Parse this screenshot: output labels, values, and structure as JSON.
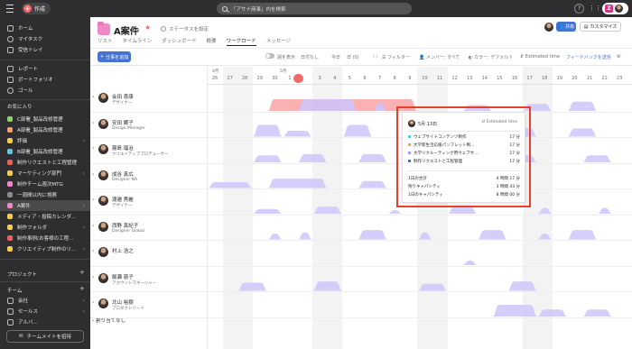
{
  "topbar": {
    "create_label": "作成",
    "search_placeholder": "「アサナ商事」内を検索",
    "help": "?",
    "org_letter": "Z"
  },
  "sidebar": {
    "nav": [
      {
        "label": "ホーム",
        "icon": "home-icon"
      },
      {
        "label": "マイタスク",
        "icon": "check-circle-icon"
      },
      {
        "label": "受信トレイ",
        "icon": "bell-icon"
      }
    ],
    "insights": [
      {
        "label": "レポート",
        "icon": "chart-icon"
      },
      {
        "label": "ポートフォリオ",
        "icon": "folder-icon"
      },
      {
        "label": "ゴール",
        "icon": "person-icon"
      }
    ],
    "favorites_heading": "お気に入り",
    "favorites": [
      {
        "label": "C部署_製品改修管理",
        "color": "#8fd16a",
        "has_chevron": false
      },
      {
        "label": "A部署_製品改修管理",
        "color": "#f2a36b",
        "has_chevron": false
      },
      {
        "label": "評価",
        "color": "#f6cc4f",
        "has_chevron": true
      },
      {
        "label": "B部署_製品改修管理",
        "color": "#62c5d9",
        "has_chevron": false
      },
      {
        "label": "制作リクエストと工程管理",
        "color": "#e8615f",
        "has_chevron": false
      },
      {
        "label": "マーケティング部門",
        "color": "#f6cc4f",
        "has_chevron": true
      },
      {
        "label": "制作チーム週次MTG",
        "color": "#f288c8",
        "has_chevron": false
      },
      {
        "label": "一週間以内に視察",
        "color": "#8a8a8c",
        "has_chevron": false
      },
      {
        "label": "A案件",
        "color": "#f288c8",
        "has_chevron": true,
        "active": true
      },
      {
        "label": "メディア・投稿カレンダ...",
        "color": "#f6cc4f",
        "has_chevron": false
      },
      {
        "label": "制作フォルダ",
        "color": "#f6cc4f",
        "has_chevron": true
      },
      {
        "label": "制作事例(お客様の工程...",
        "color": "#e8615f",
        "has_chevron": false
      },
      {
        "label": "クリエイティブ制作のリ...",
        "color": "#f6cc4f",
        "has_chevron": true
      }
    ],
    "projects_heading": "プロジェクト",
    "team_heading": "チーム",
    "teams": [
      {
        "label": "会社"
      },
      {
        "label": "セールス"
      },
      {
        "label": "アルバ..."
      }
    ],
    "invite_label": "チームメイトを招待"
  },
  "project": {
    "title": "A案件",
    "status_label": "ステータスを設定",
    "tabs": [
      "リスト",
      "タイムライン",
      "ダッシュボード",
      "概要",
      "ワークロード",
      "メッセージ"
    ],
    "active_tab": "ワークロード",
    "share_label": "共有",
    "customize_label": "カスタマイズ"
  },
  "toolbar": {
    "add_task": "仕事を追加",
    "hide_weekends": "週を表示",
    "date_label": "日付なし",
    "today": "今日",
    "range": "日 (0)",
    "filter": "フィルター",
    "members": "メンバー: すべて",
    "color": "カラー: デフォルト",
    "metric": "Estimated time",
    "feedback": "フィードバックを送信"
  },
  "timeline": {
    "months": [
      "4月",
      "5月"
    ],
    "days": [
      "26",
      "27",
      "28",
      "29",
      "30",
      "1",
      "2",
      "3",
      "4",
      "5",
      "6",
      "7",
      "8",
      "9",
      "10",
      "11",
      "12",
      "13",
      "14",
      "15",
      "16",
      "17",
      "18",
      "19",
      "20",
      "21",
      "22",
      "23"
    ],
    "today": "2"
  },
  "people": [
    {
      "name": "会田 喜康",
      "role": "デザイナー"
    },
    {
      "name": "安田 郷子",
      "role": "Design Manager"
    },
    {
      "name": "霧島 瑠治",
      "role": "クリエイティブプロデューサー"
    },
    {
      "name": "成谷 真広",
      "role": "Designer NA"
    },
    {
      "name": "渡邉 秀麗",
      "role": "デザイナー"
    },
    {
      "name": "西野 真紀子",
      "role": "Designer Global"
    },
    {
      "name": "村上 浩之",
      "role": ""
    },
    {
      "name": "飯瀬 慈子",
      "role": "アカウントマネージャー"
    },
    {
      "name": "北山 裕樹",
      "role": "プロダクトリード"
    }
  ],
  "unassigned_label": "割り当てなし",
  "tooltip": {
    "date": "5月 13日",
    "metric": "Estimated time",
    "tasks": [
      {
        "label": "ウェブサイトコンテンツ制作",
        "value": "17 分",
        "color": "#62c5d9"
      },
      {
        "label": "大学新生活応援パンフレット制...",
        "value": "17 分",
        "color": "#f2a36b"
      },
      {
        "label": "大学リクルーティング用ウェブサ...",
        "value": "17 分",
        "color": "#a9a0ec"
      },
      {
        "label": "制作リクエストと工程管理",
        "value": "17 分",
        "color": "#4573d2"
      }
    ],
    "summary": [
      {
        "label": "1日の合計",
        "value": "4 時間 17 分"
      },
      {
        "label": "残りキャパシティ",
        "value": "3 時間 43 分"
      },
      {
        "label": "1日のキャパシティ",
        "value": "8 時間 00 分"
      }
    ]
  },
  "colors": {
    "topbar_bg": "#2e2e30",
    "accent_blue": "#4573d2",
    "workload_purple": "#cdc5fa",
    "overload_red": "#f9a8ab",
    "highlight_frame": "#e8412b"
  }
}
